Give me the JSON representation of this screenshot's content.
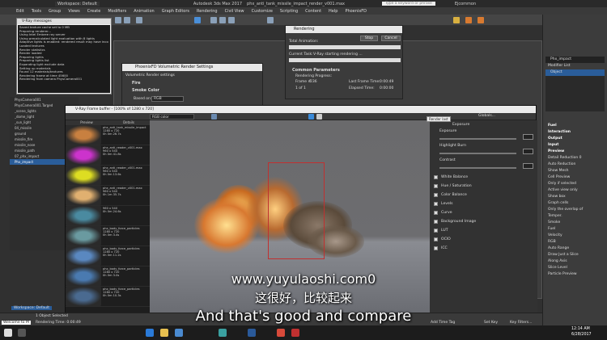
{
  "titlebar": {
    "workspace": "Workspace: Default",
    "app_title": "Autodesk 3ds Max 2017",
    "file_name": "phx_anti_tank_missile_impact_render_v001.max",
    "search_placeholder": "Type a keyword or phrase",
    "user": "Ejcommon"
  },
  "menubar": [
    "Edit",
    "Tools",
    "Group",
    "Views",
    "Create",
    "Modifiers",
    "Animation",
    "Graph Editors",
    "Rendering",
    "Civil View",
    "Customize",
    "Scripting",
    "Content",
    "Help",
    "PhoenixFD"
  ],
  "vray_messages": {
    "title": "V-Ray messages",
    "lines": [
      "Saved texture cache set to 0 MB",
      "Preparing renderer...",
      "Using Intel Embree ray server",
      "Using precalculated light evaluation with 8 lights",
      "Adaptive lights is enabled: rendered result may have incorrect",
      "Loaded textures",
      "Render statistics",
      "Render loaded",
      "Preparing lights",
      "Preparing lights list",
      "Expanding light exclude data",
      "Setting up materials",
      "Found 12 materials/textures",
      "Rendering frame at time 45600",
      "Rendering from camera PhysCamera001"
    ]
  },
  "rendering_dialog": {
    "title": "Rendering",
    "pause": "Stop",
    "cancel": "Cancel",
    "total_animation": "Total Animation:",
    "current_task_label": "Current Task:",
    "current_task": "V-Ray starting rendering ...",
    "common_params": "Common Parameters",
    "rendering_progress": "Rendering Progress:",
    "frame_label": "Frame #",
    "frame": "236",
    "of_label": "1 of 1",
    "last_frame_time_label": "Last Frame Time:",
    "last_frame_time": "0:00:49",
    "elapsed_label": "Elapsed Time:",
    "elapsed": "0:00:00"
  },
  "volumetric_dialog": {
    "title": "PhoenixFD Volumetric Render Settings",
    "sub": "Volumetric Render settings",
    "fire": "Fire",
    "smoke_color": "Smoke Color",
    "mode_label": "Based on:",
    "mode": "RGB"
  },
  "framebuffer": {
    "title": "V-Ray Frame buffer - [100% of 1280 x 720]",
    "channel": "RGB color",
    "history_headers": [
      "Preview",
      "Details"
    ],
    "history": [
      {
        "name": "phx_anti_tank_missile_impact",
        "res": "1280 x 720",
        "time": "0h 0m 26.7s",
        "color": "#c88040"
      },
      {
        "name": "phx_anti_reader_v001.max",
        "res": "960 x 540",
        "time": "0h 0m 41.8s",
        "color": "#cc33cc"
      },
      {
        "name": "phx_anti_reader_v001.max",
        "res": "960 x 540",
        "time": "0h 0m 13.6s",
        "color": "#dddd22"
      },
      {
        "name": "phx_anti_reader_v001.max",
        "res": "960 x 540",
        "time": "0h 1m 35.7s",
        "color": "#e0b070"
      },
      {
        "name": "",
        "res": "960 x 540",
        "time": "0h 0m 24.6s",
        "color": "#4a8aa0"
      },
      {
        "name": "phx_body_force_particles",
        "res": "1280 x 720",
        "time": "0h 0m 3.4s",
        "color": "#6a9aa0"
      },
      {
        "name": "phx_body_force_particles",
        "res": "1280 x 720",
        "time": "0h 0m 11.2s",
        "color": "#5a88c0"
      },
      {
        "name": "phx_body_force_particles",
        "res": "1280 x 720",
        "time": "0h 0m 3.0s",
        "color": "#4a7ab0"
      },
      {
        "name": "phx_body_force_particles",
        "res": "1280 x 720",
        "time": "0h 0m 10.3s",
        "color": "#4a6a90"
      }
    ],
    "globals_label": "Globals...",
    "corrections": {
      "exposure_header": "Exposure",
      "exposure": "Exposure",
      "highlight_burn": "Highlight Burn",
      "contrast": "Contrast",
      "items": [
        "White Balance",
        "Hue / Saturation",
        "Color Balance",
        "Levels",
        "Curve",
        "Background Image",
        "LUT",
        "OCIO",
        "ICC"
      ]
    },
    "render_last_tooltip": "Render last"
  },
  "scene_explorer": [
    "PhysCamera001",
    "PhysCamera001.Targed",
    "_scene_lights",
    "_dome_light",
    "_sun_light",
    "04_missile",
    "ground",
    "missile_fire",
    "missile_nose",
    "missile_path",
    "07_phx_impact",
    "Phx_impact"
  ],
  "command_panel": {
    "object_name": "Phx_impact",
    "modifier_list": "Modifier List",
    "modifier": "Object",
    "rollouts": [
      "Fuel",
      "Interaction",
      "Output",
      "Input",
      "Preview"
    ],
    "preview_items": [
      "Detail Reduction",
      "Auto Reduction",
      "Show Mesh",
      "Cell Preview",
      "Only if selected",
      "Active view only",
      "Show box",
      "Graph cells",
      "Only the overlap of",
      "Temper.",
      "Smoke",
      "Fuel",
      "Velocity",
      "RGB",
      "Auto Range",
      "Draw Just a Slice",
      "Along Axis",
      "Slice Level",
      "Particle Preview"
    ],
    "detail_reduction_value": "0"
  },
  "status": {
    "selected": "1 Object Selected",
    "rendering_time": "Rendering Time: 0:00:49",
    "welcome": "Welcome to M",
    "add_time_tag": "Add Time Tag",
    "set_key": "Set Key",
    "key_filters": "Key Filters..."
  },
  "workspace_bottom": "Workspace: Default",
  "subtitles": {
    "watermark": "www.yuyulaoshi.com0",
    "chinese": "这很好，比较起来",
    "english": "And that's good and compare"
  },
  "taskbar": {
    "time": "12:14 AM",
    "date": "6/28/2017"
  }
}
